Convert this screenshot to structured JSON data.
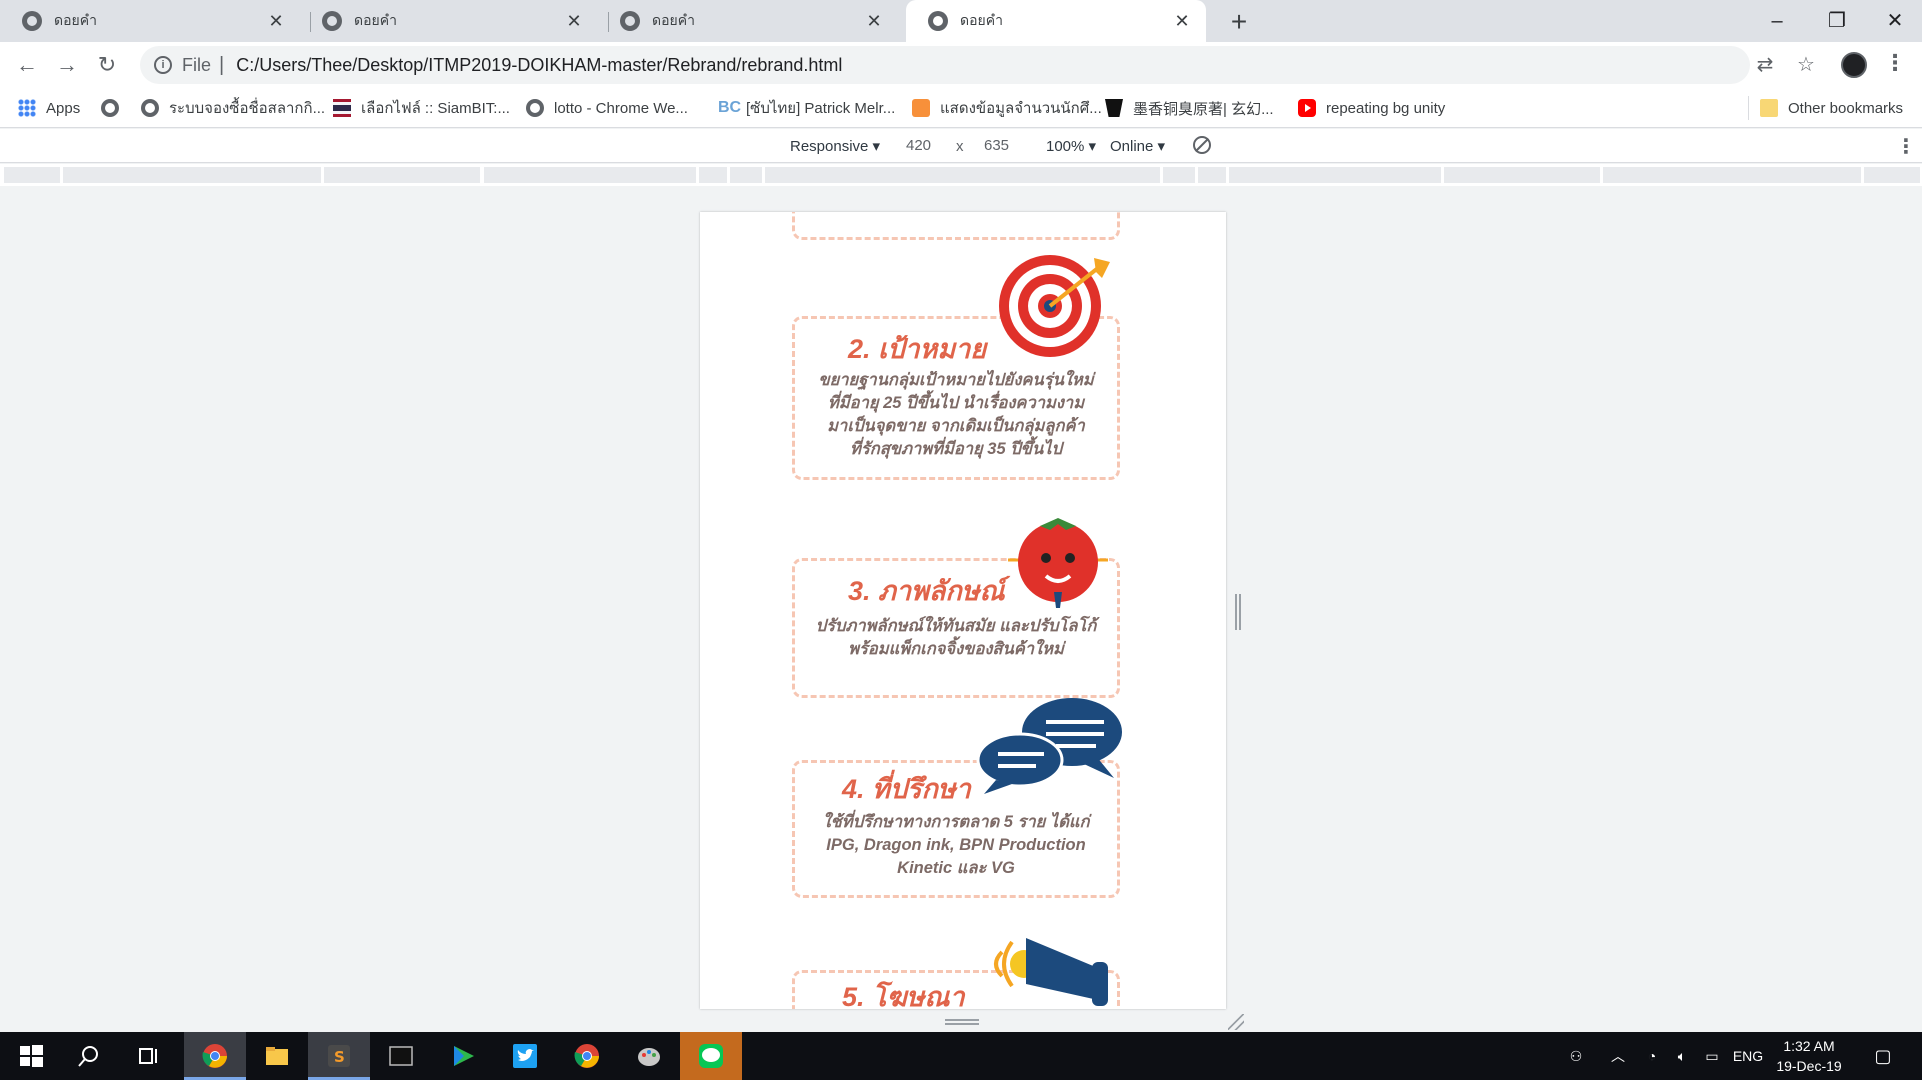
{
  "tabs": [
    {
      "title": "ดอยคำ",
      "active": false
    },
    {
      "title": "ดอยคำ",
      "active": false
    },
    {
      "title": "ดอยคำ",
      "active": false
    },
    {
      "title": "ดอยคำ",
      "active": true
    }
  ],
  "omnibox": {
    "scheme": "File",
    "url": "C:/Users/Thee/Desktop/ITMP2019-DOIKHAM-master/Rebrand/rebrand.html"
  },
  "bookmarks": {
    "apps": "Apps",
    "items": [
      "ระบบจองซื้อชื่อสลากกิ...",
      "เลือกไฟล์ :: SiamBIT:...",
      "lotto - Chrome We...",
      "[ซับไทย] Patrick Melr...",
      "แสดงข้อมูลจำนวนนักศึ...",
      "墨香铜臭原著| 玄幻...",
      "repeating bg unity"
    ],
    "other": "Other bookmarks"
  },
  "devtools": {
    "device": "Responsive",
    "width": "420",
    "times": "x",
    "height": "635",
    "zoom": "100%",
    "network": "Online"
  },
  "page": {
    "cards": [
      {
        "heading": "2. เป้าหมาย",
        "body": [
          "ขยายฐานกลุ่มเป้าหมายไปยังคนรุ่นใหม่",
          "ที่มีอายุ 25 ปีขึ้นไป นำเรื่องความงาม",
          "มาเป็นจุดขาย จากเดิมเป็นกลุ่มลูกค้า",
          "ที่รักสุขภาพที่มีอายุ 35 ปีขึ้นไป"
        ]
      },
      {
        "heading": "3. ภาพลักษณ์",
        "body": [
          "ปรับภาพลักษณ์ให้ทันสมัย  และปรับโลโก้",
          "พร้อมแพ็กเกจจิ้งของสินค้าใหม่"
        ]
      },
      {
        "heading": "4. ที่ปรึกษา",
        "body": [
          "ใช้ที่ปรึกษาทางการตลาด 5 ราย ได้แก่",
          "IPG, Dragon ink, BPN Production",
          "Kinetic และ VG"
        ]
      },
      {
        "heading": "5. โฆษณา",
        "body": []
      }
    ],
    "colors": {
      "heading": "#e0644a",
      "body": "#7d6a66",
      "border": "#f6c6b3",
      "navy": "#1c4a7d",
      "red": "#e0312a"
    }
  },
  "taskbar": {
    "tray_lang": "ENG",
    "time": "1:32 AM",
    "date": "19-Dec-19"
  }
}
